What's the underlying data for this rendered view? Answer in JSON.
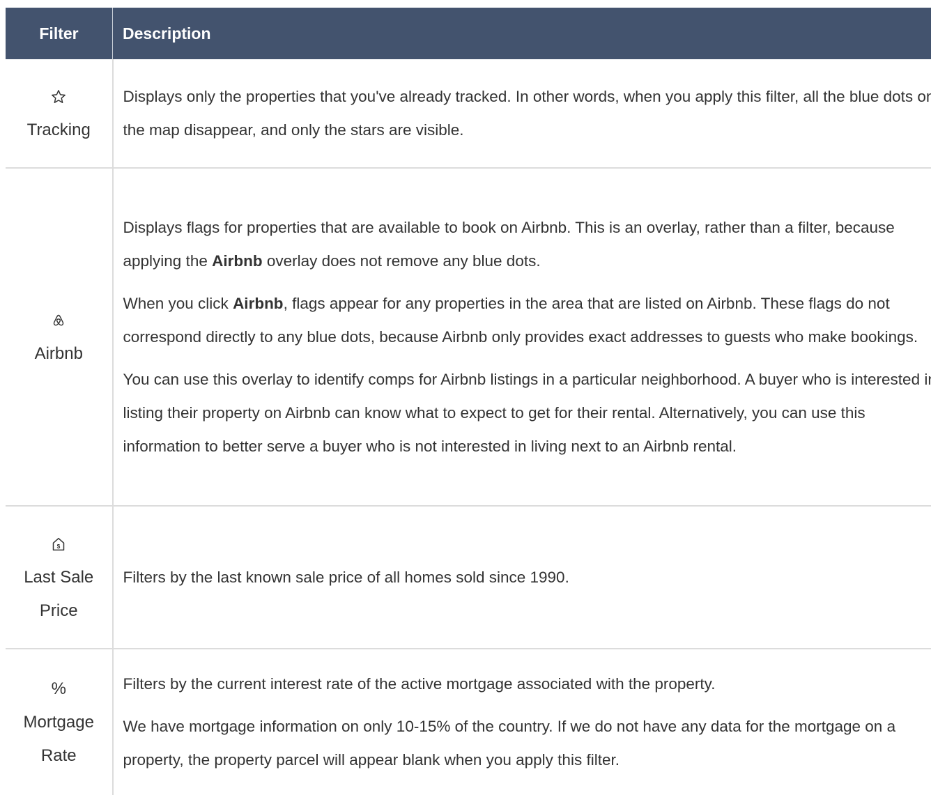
{
  "table": {
    "header": {
      "filter": "Filter",
      "description": "Description"
    },
    "rows": [
      {
        "icon": "star-outline-icon",
        "label": "Tracking",
        "paragraphs": [
          [
            "Displays only the properties that you've already tracked. In other words, when you apply this filter, all the blue dots on the map disappear, and only the stars are visible."
          ]
        ]
      },
      {
        "icon": "airbnb-logo-icon",
        "label": "Airbnb",
        "paragraphs": [
          [
            "Displays flags for properties that are available to book on Airbnb. This is an overlay, rather than a filter, because applying the ",
            "Airbnb",
            " overlay does not remove any blue dots."
          ],
          [
            "When you click ",
            "Airbnb",
            ", flags appear for any properties in the area that are listed on Airbnb. These flags do not correspond directly to any blue dots, because Airbnb only provides exact addresses to guests who make bookings."
          ],
          [
            "You can use this overlay to identify comps for Airbnb listings in a particular neighborhood. A buyer who is interested in listing their property on Airbnb can know what to expect to get for their rental. Alternatively, you can use this information to better serve a buyer who is not interested in living next to an Airbnb rental."
          ]
        ]
      },
      {
        "icon": "house-dollar-icon",
        "label": "Last Sale Price",
        "paragraphs": [
          [
            "Filters by the last known sale price of all homes sold since 1990."
          ]
        ]
      },
      {
        "icon": "percent-icon",
        "label": "Mortgage Rate",
        "icon_glyph": "%",
        "paragraphs": [
          [
            "Filters by the current interest rate of the active mortgage associated with the property."
          ],
          [
            "We have mortgage information on only 10-15% of the country. If we do not have any data for the mortgage on a property, the property parcel will appear blank when you apply this filter."
          ]
        ]
      }
    ]
  }
}
